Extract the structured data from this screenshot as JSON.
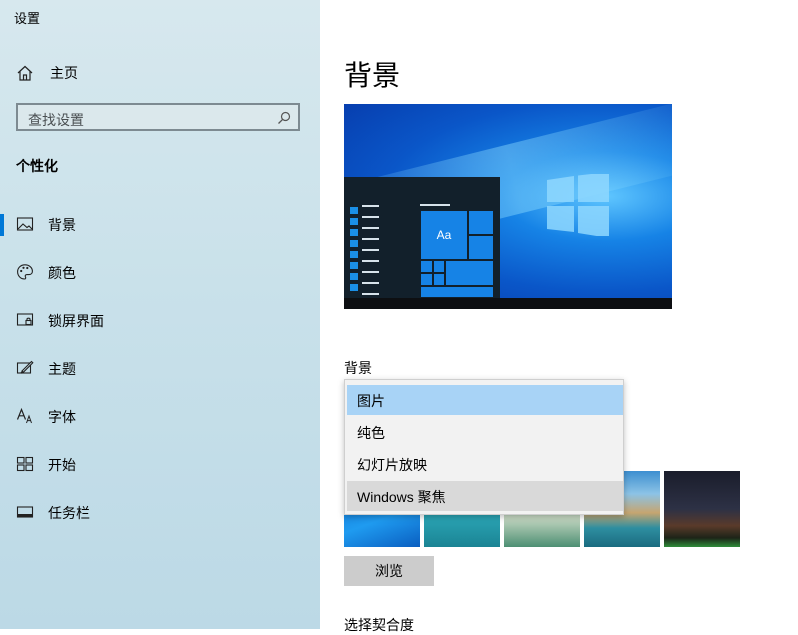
{
  "window": {
    "title": "设置"
  },
  "sidebar": {
    "home_label": "主页",
    "search": {
      "placeholder": "查找设置"
    },
    "section_title": "个性化",
    "items": [
      {
        "label": "背景",
        "icon": "picture-icon",
        "selected": true
      },
      {
        "label": "颜色",
        "icon": "palette-icon",
        "selected": false
      },
      {
        "label": "锁屏界面",
        "icon": "lock-screen-icon",
        "selected": false
      },
      {
        "label": "主题",
        "icon": "theme-brush-icon",
        "selected": false
      },
      {
        "label": "字体",
        "icon": "font-icon",
        "selected": false
      },
      {
        "label": "开始",
        "icon": "start-grid-icon",
        "selected": false
      },
      {
        "label": "任务栏",
        "icon": "taskbar-icon",
        "selected": false
      }
    ]
  },
  "main": {
    "title": "背景",
    "preview": {
      "sample_text": "Aa"
    },
    "background_label": "背景",
    "dropdown": {
      "options": [
        "图片",
        "纯色",
        "幻灯片放映",
        "Windows 聚焦"
      ],
      "selected_index": 0
    },
    "browse_label": "浏览",
    "fit_label": "选择契合度"
  },
  "colors": {
    "accent": "#0078d7",
    "selected_option": "#a8d3f6",
    "sidebar_bg": "#c9e1ea"
  }
}
